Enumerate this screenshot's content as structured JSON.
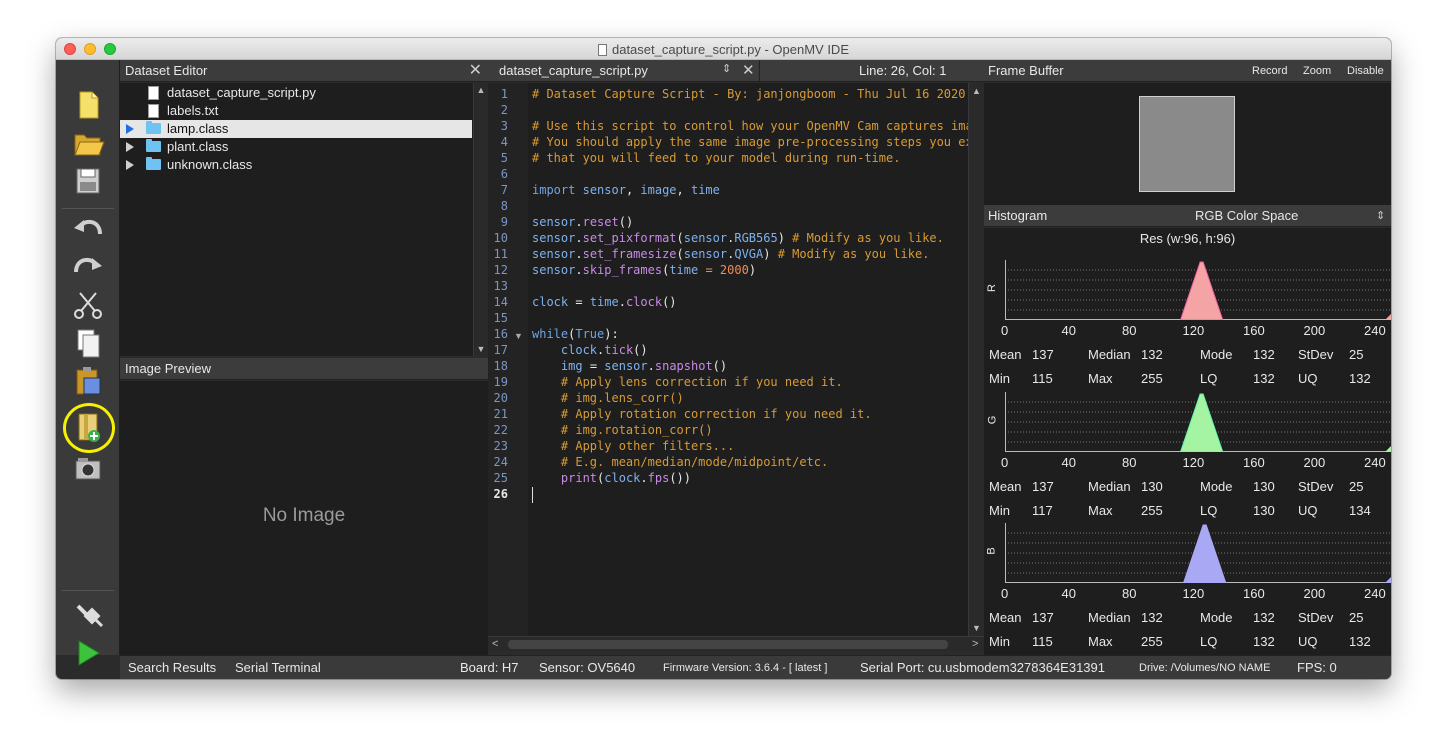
{
  "window": {
    "title": "dataset_capture_script.py - OpenMV IDE"
  },
  "toolbar": {
    "buttons": [
      "new-file-icon",
      "open-folder-icon",
      "save-icon",
      "undo-icon",
      "redo-icon",
      "cut-icon",
      "copy-icon",
      "paste-icon",
      "new-dataset-icon",
      "capture-image-icon",
      "connect-icon",
      "run-icon"
    ],
    "highlight_color": "#f6f100"
  },
  "dataset_editor": {
    "title": "Dataset Editor",
    "items": [
      {
        "label": "dataset_capture_script.py",
        "type": "file"
      },
      {
        "label": "labels.txt",
        "type": "file"
      },
      {
        "label": "lamp.class",
        "type": "folder",
        "selected": true
      },
      {
        "label": "plant.class",
        "type": "folder"
      },
      {
        "label": "unknown.class",
        "type": "folder"
      }
    ]
  },
  "image_preview": {
    "title": "Image Preview",
    "empty_text": "No Image"
  },
  "editor": {
    "tab_name": "dataset_capture_script.py",
    "cursor_position": "Line: 26, Col: 1",
    "line_numbers": [
      "1",
      "2",
      "3",
      "4",
      "5",
      "6",
      "7",
      "8",
      "9",
      "10",
      "11",
      "12",
      "13",
      "14",
      "15",
      "16",
      "17",
      "18",
      "19",
      "20",
      "21",
      "22",
      "23",
      "24",
      "25",
      "26"
    ],
    "lines": [
      "# Dataset Capture Script - By: janjongboom - Thu Jul 16 2020",
      "",
      "# Use this script to control how your OpenMV Cam captures ima",
      "# You should apply the same image pre-processing steps you ex",
      "# that you will feed to your model during run-time.",
      "",
      "import sensor, image, time",
      "",
      "sensor.reset()",
      "sensor.set_pixformat(sensor.RGB565) # Modify as you like.",
      "sensor.set_framesize(sensor.QVGA) # Modify as you like.",
      "sensor.skip_frames(time = 2000)",
      "",
      "clock = time.clock()",
      "",
      "while(True):",
      "    clock.tick()",
      "    img = sensor.snapshot()",
      "    # Apply lens correction if you need it.",
      "    # img.lens_corr()",
      "    # Apply rotation correction if you need it.",
      "    # img.rotation_corr()",
      "    # Apply other filters...",
      "    # E.g. mean/median/mode/midpoint/etc.",
      "    print(clock.fps())",
      ""
    ]
  },
  "frame_buffer": {
    "title": "Frame Buffer",
    "record_label": "Record",
    "zoom_label": "Zoom",
    "disable_label": "Disable"
  },
  "histogram": {
    "title": "Histogram",
    "color_space": "RGB Color Space",
    "resolution": "Res (w:96, h:96)",
    "x_ticks": [
      "0",
      "40",
      "80",
      "120",
      "160",
      "200",
      "240"
    ],
    "stat_labels": {
      "mean": "Mean",
      "median": "Median",
      "mode": "Mode",
      "stdev": "StDev",
      "min": "Min",
      "max": "Max",
      "lq": "LQ",
      "uq": "UQ"
    },
    "channels": [
      {
        "name": "R",
        "color": "#f4a4a4",
        "peak": 130,
        "stats": {
          "mean": "137",
          "median": "132",
          "mode": "132",
          "stdev": "25",
          "min": "115",
          "max": "255",
          "lq": "132",
          "uq": "132"
        }
      },
      {
        "name": "G",
        "color": "#a4f4a4",
        "peak": 130,
        "stats": {
          "mean": "137",
          "median": "130",
          "mode": "130",
          "stdev": "25",
          "min": "117",
          "max": "255",
          "lq": "130",
          "uq": "134"
        }
      },
      {
        "name": "B",
        "color": "#a8a8f4",
        "peak": 132,
        "stats": {
          "mean": "137",
          "median": "132",
          "mode": "132",
          "stdev": "25",
          "min": "115",
          "max": "255",
          "lq": "132",
          "uq": "132"
        }
      }
    ]
  },
  "statusbar": {
    "search_results": "Search Results",
    "serial_terminal": "Serial Terminal",
    "board": "Board: H7",
    "sensor": "Sensor: OV5640",
    "firmware": "Firmware Version: 3.6.4 - [ latest ]",
    "serial_port": "Serial Port: cu.usbmodem3278364E31391",
    "drive": "Drive: /Volumes/NO NAME",
    "fps": "FPS: 0"
  }
}
